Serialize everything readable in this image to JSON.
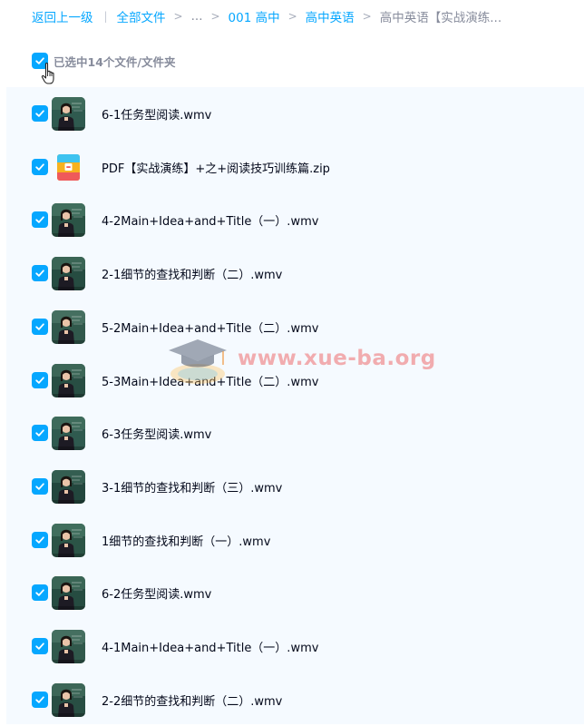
{
  "breadcrumb": {
    "back": "返回上一级",
    "all_files": "全部文件",
    "ellipsis": "...",
    "level1": "001 高中",
    "level2": "高中英语",
    "current": "高中英语【实战演练..."
  },
  "selection": {
    "label": "已选中14个文件/文件夹",
    "checked": true
  },
  "watermark": {
    "text": "www.xue-ba.org"
  },
  "files": [
    {
      "name": "6-1任务型阅读.wmv",
      "type": "video",
      "checked": true
    },
    {
      "name": "PDF【实战演练】+之+阅读技巧训练篇.zip",
      "type": "zip",
      "checked": true
    },
    {
      "name": "4-2Main+Idea+and+Title（一）.wmv",
      "type": "video",
      "checked": true
    },
    {
      "name": "2-1细节的查找和判断（二）.wmv",
      "type": "video",
      "checked": true
    },
    {
      "name": "5-2Main+Idea+and+Title（二）.wmv",
      "type": "video",
      "checked": true
    },
    {
      "name": "5-3Main+Idea+and+Title（二）.wmv",
      "type": "video",
      "checked": true
    },
    {
      "name": "6-3任务型阅读.wmv",
      "type": "video",
      "checked": true
    },
    {
      "name": "3-1细节的查找和判断（三）.wmv",
      "type": "video",
      "checked": true
    },
    {
      "name": "1细节的查找和判断（一）.wmv",
      "type": "video",
      "checked": true
    },
    {
      "name": "6-2任务型阅读.wmv",
      "type": "video",
      "checked": true
    },
    {
      "name": "4-1Main+Idea+and+Title（一）.wmv",
      "type": "video",
      "checked": true
    },
    {
      "name": "2-2细节的查找和判断（二）.wmv",
      "type": "video",
      "checked": true
    }
  ],
  "colors": {
    "accent": "#06a7ff",
    "muted_text": "#878c9c",
    "list_bg": "#f5faff",
    "file_text": "#03081a",
    "watermark": "#ed4d4d"
  },
  "icons": {
    "checkbox": "check-icon",
    "video": "video-thumbnail",
    "zip": "zip-icon",
    "cursor": "hand-pointer-icon",
    "watermark_logo": "graduation-cap-icon"
  }
}
